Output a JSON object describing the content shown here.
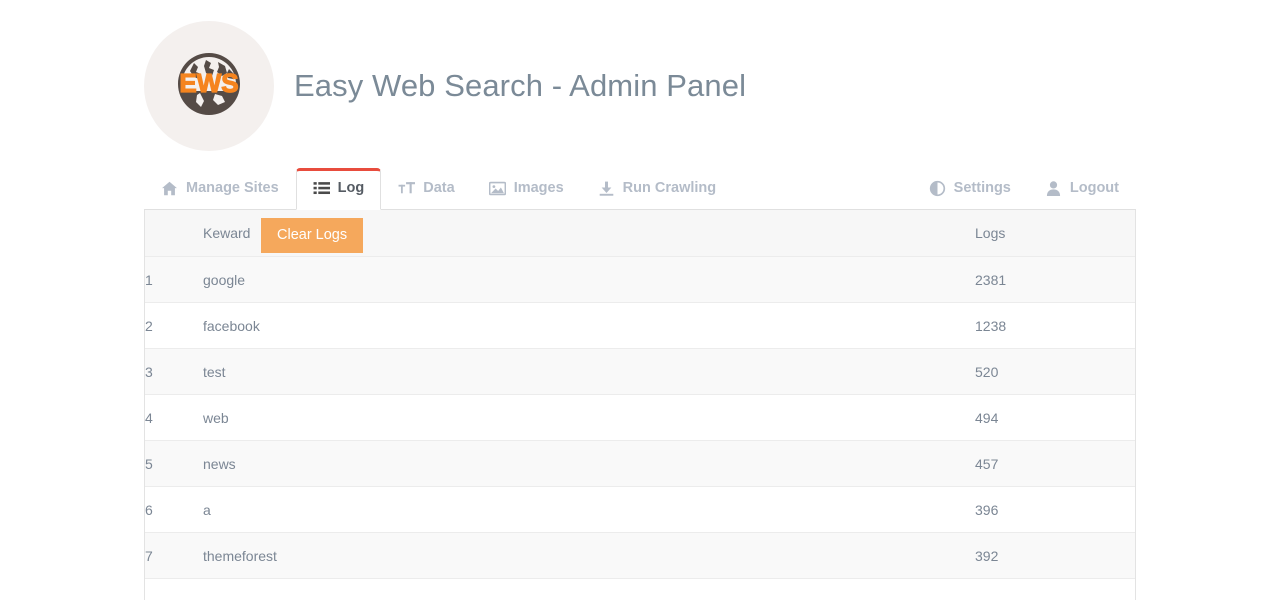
{
  "header": {
    "logo": {
      "icon": "globe-icon",
      "text": "EWS",
      "text_color": "#f5841f",
      "globe_color": "#554b46",
      "circle_bg": "#f4f0ee"
    },
    "title": "Easy Web Search - Admin Panel"
  },
  "nav": {
    "left_tabs": [
      {
        "label": "Manage Sites",
        "icon": "home-icon",
        "active": false
      },
      {
        "label": "Log",
        "icon": "list-icon",
        "active": true
      },
      {
        "label": "Data",
        "icon": "text-height-icon",
        "active": false
      },
      {
        "label": "Images",
        "icon": "image-icon",
        "active": false
      },
      {
        "label": "Run Crawling",
        "icon": "download-icon",
        "active": false
      }
    ],
    "right_tabs": [
      {
        "label": "Settings",
        "icon": "adjust-icon",
        "active": false
      },
      {
        "label": "Logout",
        "icon": "user-icon",
        "active": false
      }
    ],
    "active_tab_accent": "#e84c3d"
  },
  "table": {
    "headers": {
      "index": "",
      "keyword": "Keward",
      "logs": "Logs"
    },
    "clear_button": {
      "label": "Clear Logs",
      "color": "#f5a85c"
    },
    "rows": [
      {
        "index": "1",
        "keyword": "google",
        "logs": "2381"
      },
      {
        "index": "2",
        "keyword": "facebook",
        "logs": "1238"
      },
      {
        "index": "3",
        "keyword": "test",
        "logs": "520"
      },
      {
        "index": "4",
        "keyword": "web",
        "logs": "494"
      },
      {
        "index": "5",
        "keyword": "news",
        "logs": "457"
      },
      {
        "index": "6",
        "keyword": "a",
        "logs": "396"
      },
      {
        "index": "7",
        "keyword": "themeforest",
        "logs": "392"
      }
    ]
  }
}
